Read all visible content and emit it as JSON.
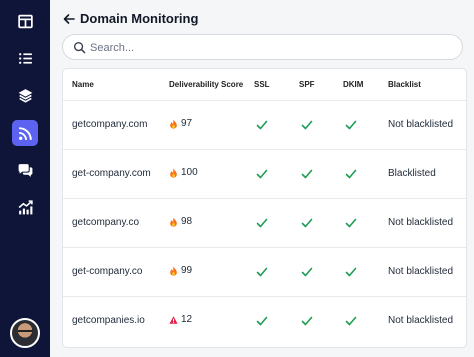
{
  "header": {
    "title": "Domain Monitoring"
  },
  "search": {
    "placeholder": "Search..."
  },
  "table": {
    "columns": [
      "Name",
      "Deliverability Score",
      "SSL",
      "SPF",
      "DKIM",
      "Blacklist"
    ],
    "rows": [
      {
        "name": "getcompany.com",
        "score_icon": "fire-icon",
        "score": "97",
        "ssl": true,
        "spf": true,
        "dkim": true,
        "blacklist": "Not blacklisted"
      },
      {
        "name": "get-company.com",
        "score_icon": "fire-icon",
        "score": "100",
        "ssl": true,
        "spf": true,
        "dkim": true,
        "blacklist": "Blacklisted"
      },
      {
        "name": "getcompany.co",
        "score_icon": "fire-icon",
        "score": "98",
        "ssl": true,
        "spf": true,
        "dkim": true,
        "blacklist": "Not blacklisted"
      },
      {
        "name": "get-company.co",
        "score_icon": "fire-icon",
        "score": "99",
        "ssl": true,
        "spf": true,
        "dkim": true,
        "blacklist": "Not blacklisted"
      },
      {
        "name": "getcompanies.io",
        "score_icon": "warning-icon",
        "score": "12",
        "ssl": true,
        "spf": true,
        "dkim": true,
        "blacklist": "Not blacklisted"
      }
    ]
  },
  "sidebar": {
    "items": [
      {
        "icon": "table-layout-icon",
        "active": false
      },
      {
        "icon": "list-icon",
        "active": false
      },
      {
        "icon": "layers-icon",
        "active": false
      },
      {
        "icon": "rss-icon",
        "active": true
      },
      {
        "icon": "chat-icon",
        "active": false
      },
      {
        "icon": "trending-up-chart-icon",
        "active": false
      }
    ],
    "avatar": "user-avatar"
  },
  "colors": {
    "sidebar_bg": "#0f1538",
    "accent": "#5b63f0",
    "check": "#1f9d55",
    "fire": "#f97316",
    "warning": "#e11d48"
  }
}
